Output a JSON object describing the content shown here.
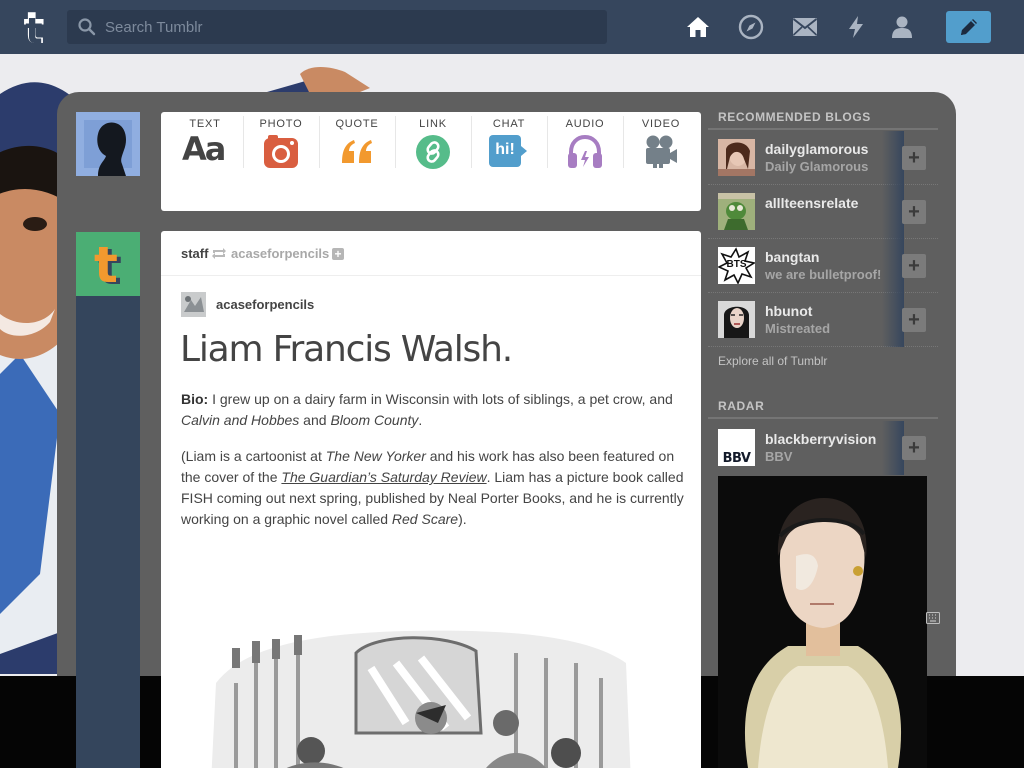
{
  "topbar": {
    "search_placeholder": "Search Tumblr",
    "nav_icons": [
      "home-icon",
      "compass-icon",
      "mail-icon",
      "lightning-icon",
      "person-icon"
    ],
    "compose_icon": "pencil-icon",
    "bar_color": "#36465d",
    "compose_color": "#529ecc"
  },
  "post_types": [
    {
      "label": "TEXT",
      "glyph": "Aa",
      "color": "#444444"
    },
    {
      "label": "PHOTO",
      "color": "#d95e40"
    },
    {
      "label": "QUOTE",
      "color": "#f2992e"
    },
    {
      "label": "LINK",
      "color": "#56bc8a"
    },
    {
      "label": "CHAT",
      "glyph": "hi!",
      "color": "#529ecc"
    },
    {
      "label": "AUDIO",
      "color": "#a77dc2"
    },
    {
      "label": "VIDEO",
      "color": "#748089"
    }
  ],
  "post": {
    "poster": "staff",
    "reblogged_from": "acaseforpencils",
    "source_blog": "acaseforpencils",
    "title": "Liam Francis Walsh.",
    "bio_label": "Bio:",
    "bio_text": " I grew up on a dairy farm in Wisconsin with lots of siblings, a pet crow, and ",
    "bio_book1": "Calvin and Hobbes",
    "bio_and": " and ",
    "bio_book2": "Bloom County",
    "bio_end": ".",
    "p2_a": "(Liam is a cartoonist at ",
    "p2_mag": "The New Yorker",
    "p2_b": " and his work has also been featured on the cover of the ",
    "p2_link": "The Guardian’s Saturday Review",
    "p2_c": ". Liam has a picture book called FISH coming out next spring, published by Neal Porter Books, and he is currently working on a graphic novel called ",
    "p2_novel": "Red Scare",
    "p2_d": ")."
  },
  "sidebar": {
    "recommended_heading": "RECOMMENDED BLOGS",
    "blogs": [
      {
        "name": "dailyglamorous",
        "subtitle": "Daily Glamorous"
      },
      {
        "name": "alllteensrelate",
        "subtitle": ""
      },
      {
        "name": "bangtan",
        "subtitle": "we are bulletproof!"
      },
      {
        "name": "hbunot",
        "subtitle": "Mistreated"
      }
    ],
    "explore_link": "Explore all of Tumblr",
    "radar_heading": "RADAR",
    "radar_blog": {
      "name": "blackberryvision",
      "subtitle": "BBV",
      "avatar_text": "BBV"
    }
  },
  "misc": {
    "add_symbol": "+",
    "bangtan_avatar_text": "BTS"
  }
}
